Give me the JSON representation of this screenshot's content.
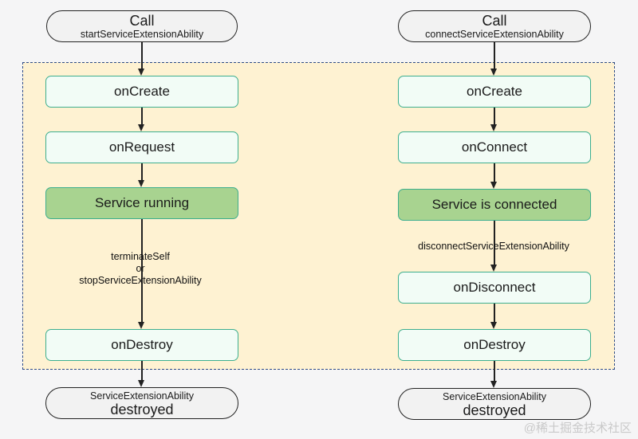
{
  "left_flow": {
    "start": {
      "title": "Call",
      "subtitle": "startServiceExtensionAbility"
    },
    "steps": [
      "onCreate",
      "onRequest",
      "Service running",
      "onDestroy"
    ],
    "edge_label": [
      "terminateSelf",
      "or",
      "stopServiceExtensionAbility"
    ],
    "end": {
      "subtitle": "ServiceExtensionAbility",
      "title": "destroyed"
    }
  },
  "right_flow": {
    "start": {
      "title": "Call",
      "subtitle": "connectServiceExtensionAbility"
    },
    "steps": [
      "onCreate",
      "onConnect",
      "Service is connected",
      "onDisconnect",
      "onDestroy"
    ],
    "edge_label": "disconnectServiceExtensionAbility",
    "end": {
      "subtitle": "ServiceExtensionAbility",
      "title": "destroyed"
    }
  },
  "watermark": "@稀土掘金技术社区",
  "colors": {
    "region_bg": "#fef2d2",
    "region_border": "#2c4a86",
    "step_bg": "#f2fcf6",
    "step_border": "#3dae8e",
    "active_bg": "#a8d390",
    "pill_bg": "#f2f2f2"
  }
}
